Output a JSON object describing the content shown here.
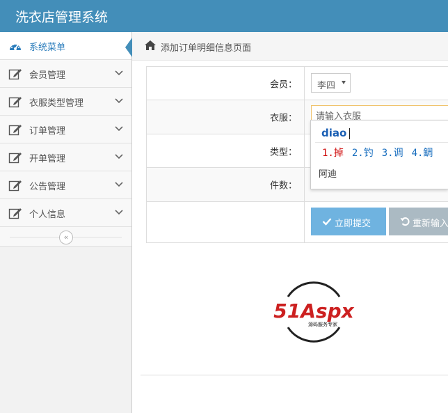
{
  "app": {
    "title": "洗衣店管理系统"
  },
  "sidebar": {
    "items": [
      {
        "label": "系统菜单",
        "icon": "dashboard-icon",
        "active": true
      },
      {
        "label": "会员管理",
        "icon": "edit-icon"
      },
      {
        "label": "衣服类型管理",
        "icon": "edit-icon"
      },
      {
        "label": "订单管理",
        "icon": "edit-icon"
      },
      {
        "label": "开单管理",
        "icon": "edit-icon"
      },
      {
        "label": "公告管理",
        "icon": "edit-icon"
      },
      {
        "label": "个人信息",
        "icon": "edit-icon"
      }
    ],
    "collapse_icon": "double-chevron-left-icon"
  },
  "breadcrumb": {
    "icon": "home-icon",
    "text": "添加订单明细信息页面"
  },
  "form": {
    "member_label": "会员：",
    "member_value": "李四",
    "clothes_label": "衣服：",
    "clothes_placeholder": "请输入衣服",
    "type_label": "类型：",
    "count_label": "件数：",
    "submit_label": "立即提交",
    "reset_label": "重新输入"
  },
  "ime": {
    "pinyin": "diao",
    "candidates": [
      "1.掉",
      "2.钓",
      "3.调",
      "4.鲷"
    ],
    "suggestion": "阿迪"
  },
  "logo": {
    "text_main": "51Aspx",
    "text_sub": "源码服务专家"
  },
  "colors": {
    "header": "#438eb9",
    "submit": "#6fb3e0",
    "reset": "#abbac3",
    "accent": "#2b7dbc"
  }
}
